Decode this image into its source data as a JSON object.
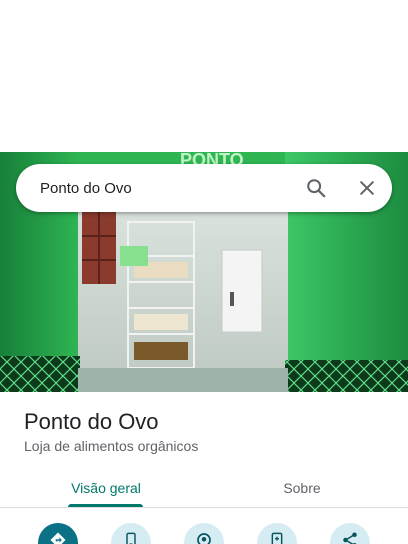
{
  "search": {
    "query": "Ponto do Ovo"
  },
  "place": {
    "name": "Ponto do Ovo",
    "category": "Loja de alimentos orgânicos"
  },
  "tabs": [
    {
      "label": "Visão geral",
      "active": true
    },
    {
      "label": "Sobre",
      "active": false
    }
  ],
  "actions": [
    {
      "icon": "directions-icon"
    },
    {
      "icon": "phone-icon"
    },
    {
      "icon": "nearby-icon"
    },
    {
      "icon": "send-to-phone-icon"
    },
    {
      "icon": "share-icon"
    }
  ],
  "colors": {
    "accent": "#00796b",
    "primary_action": "#0b7285",
    "secondary_action": "#d6ecf3",
    "store_wall": "#1f8a3e"
  }
}
